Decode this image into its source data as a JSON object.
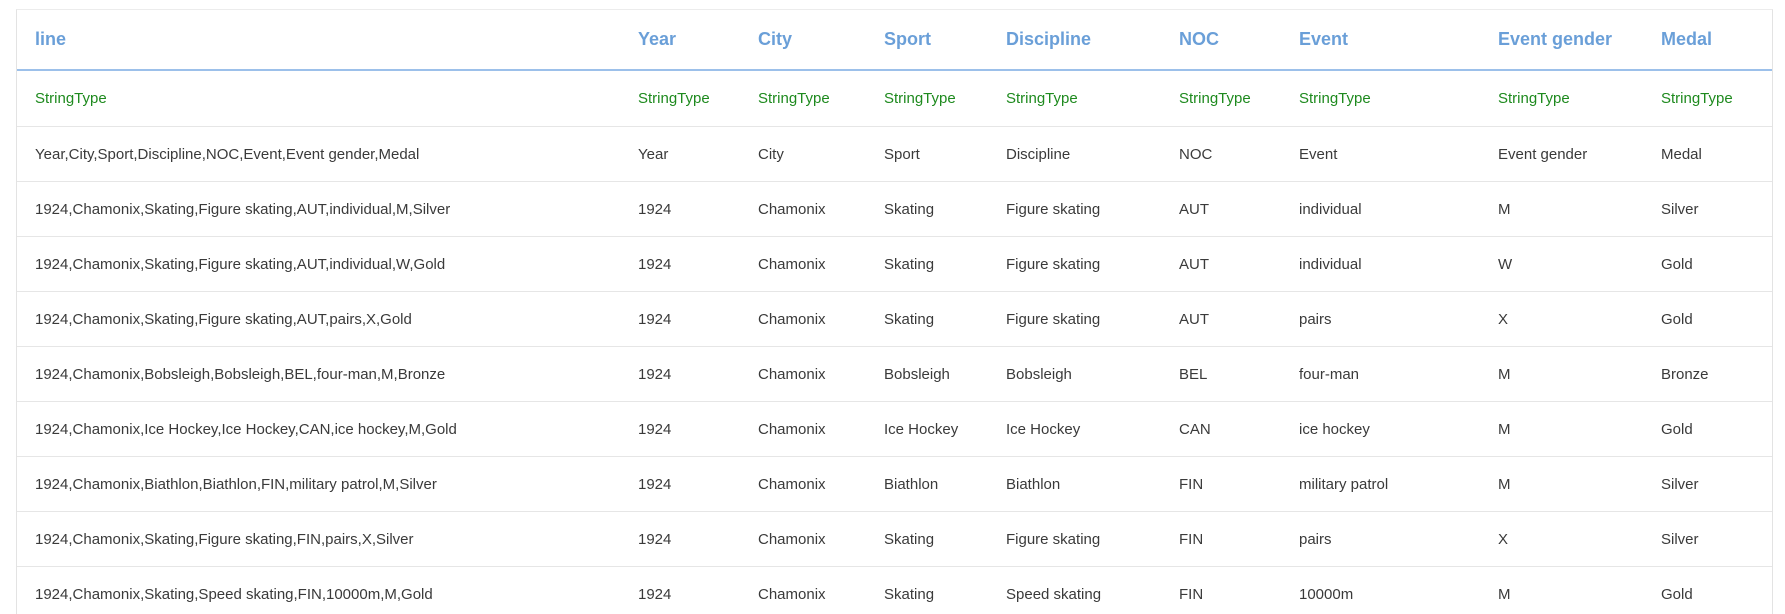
{
  "table": {
    "columns": [
      "line",
      "Year",
      "City",
      "Sport",
      "Discipline",
      "NOC",
      "Event",
      "Event gender",
      "Medal"
    ],
    "types": [
      "StringType",
      "StringType",
      "StringType",
      "StringType",
      "StringType",
      "StringType",
      "StringType",
      "StringType",
      "StringType"
    ],
    "rows": [
      [
        "Year,City,Sport,Discipline,NOC,Event,Event gender,Medal",
        "Year",
        "City",
        "Sport",
        "Discipline",
        "NOC",
        "Event",
        "Event gender",
        "Medal"
      ],
      [
        "1924,Chamonix,Skating,Figure skating,AUT,individual,M,Silver",
        "1924",
        "Chamonix",
        "Skating",
        "Figure skating",
        "AUT",
        "individual",
        "M",
        "Silver"
      ],
      [
        "1924,Chamonix,Skating,Figure skating,AUT,individual,W,Gold",
        "1924",
        "Chamonix",
        "Skating",
        "Figure skating",
        "AUT",
        "individual",
        "W",
        "Gold"
      ],
      [
        "1924,Chamonix,Skating,Figure skating,AUT,pairs,X,Gold",
        "1924",
        "Chamonix",
        "Skating",
        "Figure skating",
        "AUT",
        "pairs",
        "X",
        "Gold"
      ],
      [
        "1924,Chamonix,Bobsleigh,Bobsleigh,BEL,four-man,M,Bronze",
        "1924",
        "Chamonix",
        "Bobsleigh",
        "Bobsleigh",
        "BEL",
        "four-man",
        "M",
        "Bronze"
      ],
      [
        "1924,Chamonix,Ice Hockey,Ice Hockey,CAN,ice hockey,M,Gold",
        "1924",
        "Chamonix",
        "Ice Hockey",
        "Ice Hockey",
        "CAN",
        "ice hockey",
        "M",
        "Gold"
      ],
      [
        "1924,Chamonix,Biathlon,Biathlon,FIN,military patrol,M,Silver",
        "1924",
        "Chamonix",
        "Biathlon",
        "Biathlon",
        "FIN",
        "military patrol",
        "M",
        "Silver"
      ],
      [
        "1924,Chamonix,Skating,Figure skating,FIN,pairs,X,Silver",
        "1924",
        "Chamonix",
        "Skating",
        "Figure skating",
        "FIN",
        "pairs",
        "X",
        "Silver"
      ],
      [
        "1924,Chamonix,Skating,Speed skating,FIN,10000m,M,Gold",
        "1924",
        "Chamonix",
        "Skating",
        "Speed skating",
        "FIN",
        "10000m",
        "M",
        "Gold"
      ]
    ]
  },
  "colors": {
    "header_text": "#6a9fd8",
    "header_border": "#9cc0ea",
    "type_text": "#1e8a1e",
    "row_border": "#e6e6e6"
  }
}
